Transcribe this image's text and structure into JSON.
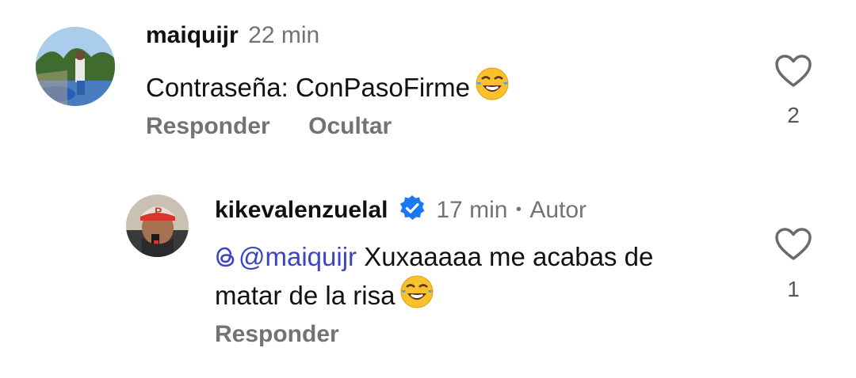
{
  "comments": [
    {
      "username": "maiquijr",
      "time": "22 min",
      "text": "Contraseña: ConPasoFirme",
      "emoji": "face-with-tears-of-joy",
      "actions": [
        "Responder",
        "Ocultar"
      ],
      "likes": "2"
    },
    {
      "username": "kikevalenzuelal",
      "verified": true,
      "time": "17 min",
      "separator": "•",
      "author_label": "Autor",
      "mention": "@maiquijr",
      "text_line1": " Xuxaaaaa me acabas de",
      "text_line2": "matar de la risa",
      "emoji": "face-with-tears-of-joy",
      "actions": [
        "Responder"
      ],
      "likes": "1"
    }
  ],
  "colors": {
    "mention": "#3b45c4",
    "verified": "#1a77f2",
    "muted": "#737373"
  }
}
